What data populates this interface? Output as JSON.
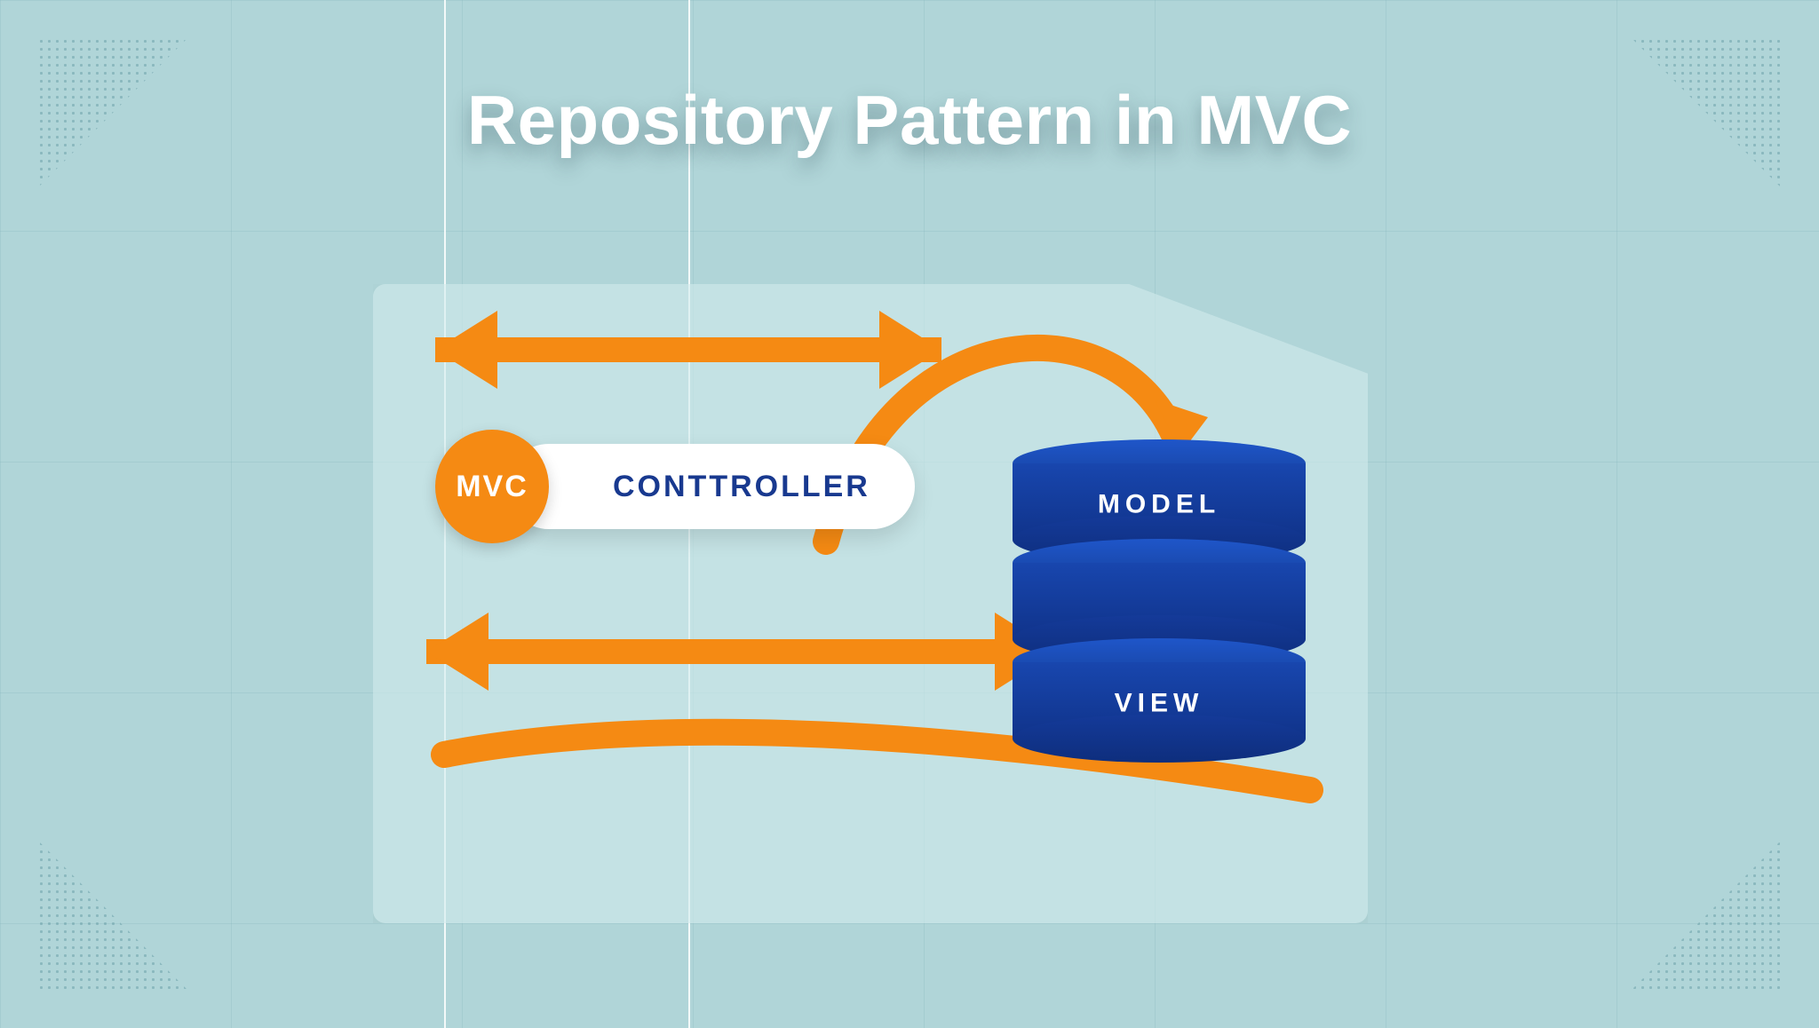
{
  "title": "Repository Pattern in MVC",
  "mvc": {
    "circle_label": "MVC",
    "controller_label": "CONTTROLLER"
  },
  "db": {
    "top_label": "MODEL",
    "middle_label": "",
    "bottom_label": "VIEW"
  },
  "colors": {
    "background": "#b0d5d8",
    "arrow": "#f58a13",
    "accent_orange": "#f58a13",
    "blue": "#15409c",
    "text_blue": "#18398f",
    "white": "#ffffff"
  }
}
